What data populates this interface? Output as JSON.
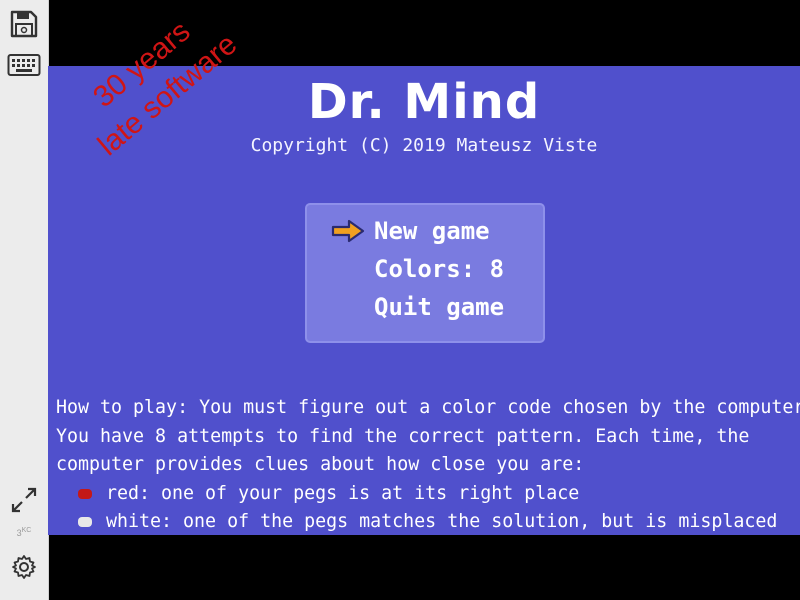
{
  "game": {
    "title": "Dr. Mind",
    "copyright": "Copyright (C) 2019 Mateusz Viste",
    "menu": {
      "items": [
        {
          "label": "New game",
          "selected": true
        },
        {
          "label": "Colors: 8",
          "selected": false
        },
        {
          "label": "Quit game",
          "selected": false
        }
      ],
      "cursor_icon": "arrow-right-icon"
    },
    "instructions": [
      "How to play: You must figure out a color code chosen by the computer.",
      "You have 8 attempts to find the correct pattern. Each time, the",
      "computer provides clues about how close you are:"
    ],
    "clues": [
      {
        "color": "#c41818",
        "text": "red: one of your pegs is at its right place"
      },
      {
        "color": "#e8e8e8",
        "text": "white: one of the pegs matches the solution, but is misplaced"
      }
    ]
  },
  "watermark": {
    "line1": "30 years",
    "line2": "late software"
  },
  "toolbar": {
    "icons": [
      "save-icon",
      "keyboard-icon",
      "fullscreen-icon",
      "settings-icon"
    ],
    "speed_value": "3",
    "speed_unit": "KC"
  },
  "colors": {
    "screen_bg": "#5050cc",
    "menu_bg": "#7a7be0",
    "arrow": "#f0a020",
    "watermark": "#d01515"
  }
}
